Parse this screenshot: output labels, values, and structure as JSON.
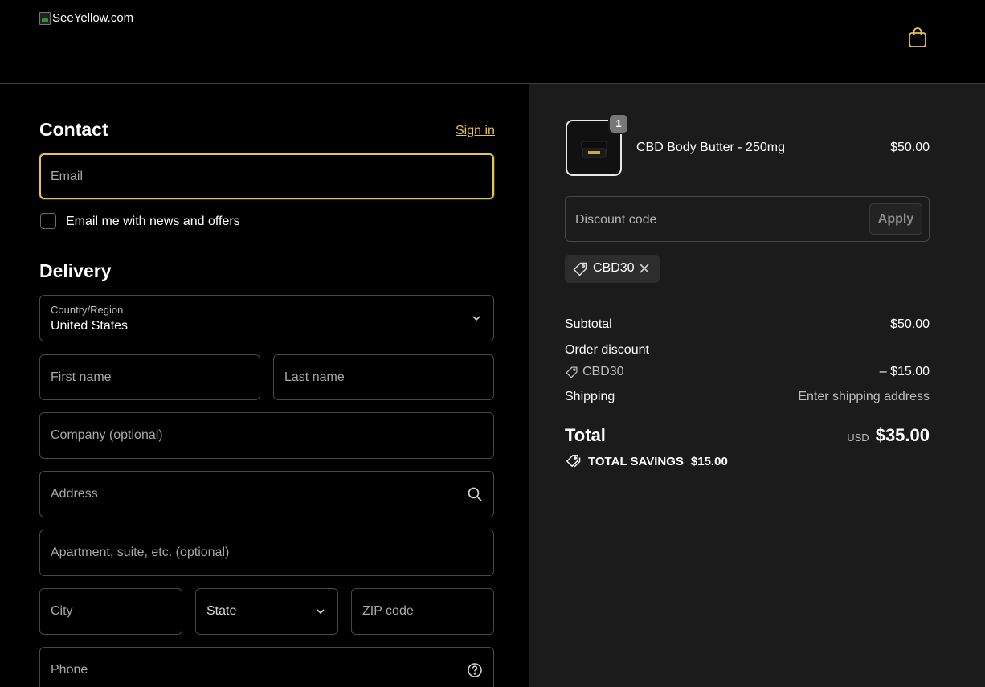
{
  "header": {
    "logo_alt": "SeeYellow.com",
    "cart_icon": "shopping-bag-icon"
  },
  "contact": {
    "title": "Contact",
    "signin_label": "Sign in",
    "email_placeholder": "Email",
    "newsletter_label": "Email me with news and offers"
  },
  "delivery": {
    "title": "Delivery",
    "country_label": "Country/Region",
    "country_value": "United States",
    "first_name_placeholder": "First name",
    "last_name_placeholder": "Last name",
    "company_placeholder": "Company (optional)",
    "address_placeholder": "Address",
    "apartment_placeholder": "Apartment, suite, etc. (optional)",
    "city_placeholder": "City",
    "state_placeholder": "State",
    "zip_placeholder": "ZIP code",
    "phone_placeholder": "Phone"
  },
  "summary": {
    "product": {
      "name": "CBD Body Butter - 250mg",
      "price": "$50.00",
      "quantity": "1"
    },
    "discount_placeholder": "Discount code",
    "apply_label": "Apply",
    "applied_code": "CBD30",
    "subtotal_label": "Subtotal",
    "subtotal_value": "$50.00",
    "order_discount_label": "Order discount",
    "order_discount_code": "CBD30",
    "order_discount_value": "– $15.00",
    "shipping_label": "Shipping",
    "shipping_value": "Enter shipping address",
    "total_label": "Total",
    "total_currency": "USD",
    "total_value": "$35.00",
    "savings_label": "TOTAL SAVINGS",
    "savings_value": "$15.00"
  },
  "colors": {
    "accent": "#e7c54b",
    "page_bg": "#000000",
    "summary_bg": "#1b1b1b",
    "border": "#474747"
  }
}
